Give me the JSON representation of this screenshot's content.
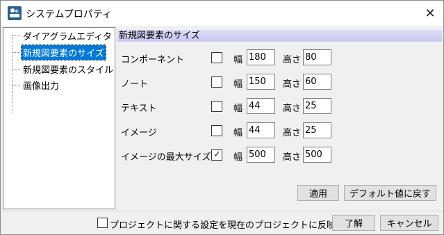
{
  "window": {
    "title": "システムプロパティ",
    "close_glyph": "✕"
  },
  "tree": {
    "items": [
      {
        "label": "ダイアグラムエディタ",
        "selected": false
      },
      {
        "label": "新規図要素のサイズ",
        "selected": true
      },
      {
        "label": "新規図要素のスタイル",
        "selected": false
      },
      {
        "label": "画像出力",
        "selected": false
      }
    ]
  },
  "section": {
    "title": "新規図要素のサイズ"
  },
  "labels": {
    "width": "幅",
    "height": "高さ"
  },
  "rows": [
    {
      "label": "コンポーネント",
      "checked": false,
      "width": "180",
      "height": "80"
    },
    {
      "label": "ノート",
      "checked": false,
      "width": "150",
      "height": "60"
    },
    {
      "label": "テキスト",
      "checked": false,
      "width": "44",
      "height": "25"
    },
    {
      "label": "イメージ",
      "checked": false,
      "width": "44",
      "height": "25"
    },
    {
      "label": "イメージの最大サイズ",
      "checked": true,
      "width": "500",
      "height": "500"
    }
  ],
  "buttons": {
    "apply": "適用",
    "reset_default": "デフォルト値に戻す",
    "ok": "了解",
    "cancel": "キャンセル"
  },
  "footer": {
    "reflect_label": "プロジェクトに関する設定を現在のプロジェクトに反映する",
    "reflect_checked": false
  },
  "check_glyph": "✓"
}
